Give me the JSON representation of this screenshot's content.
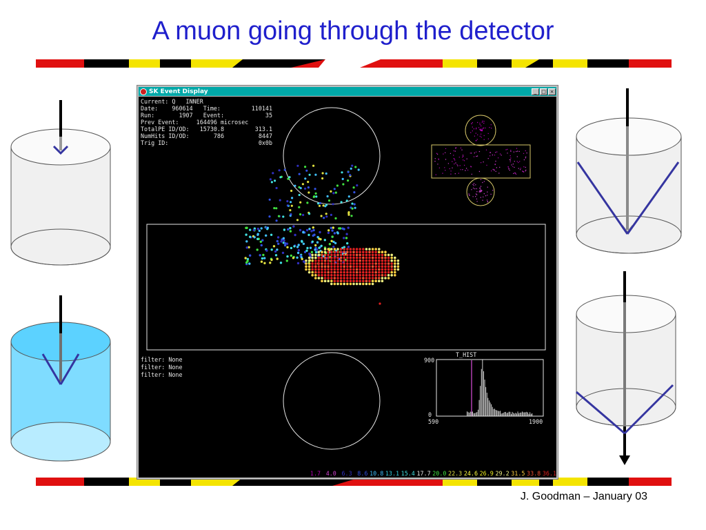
{
  "slide": {
    "title": "A muon going through the detector",
    "footer": "J. Goodman – January 03"
  },
  "window": {
    "title": "SK Event Display",
    "buttons": {
      "minimize": "_",
      "maximize": "□",
      "close": "×"
    }
  },
  "event_info": [
    {
      "label": "Current: Q   INNER",
      "value": ""
    },
    {
      "label": "Date:    960614   Time:",
      "value": "110141"
    },
    {
      "label": "Run:       1907   Event:",
      "value": "35"
    },
    {
      "label": "Prev Event:     164496 microsec",
      "value": ""
    },
    {
      "label": "TotalPE ID/OD:   15730.8",
      "value": "313.1"
    },
    {
      "label": "NumHits ID/OD:       786",
      "value": "8447"
    },
    {
      "label": "Trig ID:",
      "value": "0x0b"
    }
  ],
  "filters": [
    "filter: None",
    "filter: None",
    "filter: None"
  ],
  "histogram": {
    "title": "T_HIST",
    "ymax": "900",
    "ymin": "0",
    "xmin": "590",
    "xmax": "1900"
  },
  "color_scale": [
    {
      "value": "1.7",
      "color": "#b000b0"
    },
    {
      "value": "4.0",
      "color": "#d040d0"
    },
    {
      "value": "6.3",
      "color": "#3030c0"
    },
    {
      "value": "8.6",
      "color": "#3050e0"
    },
    {
      "value": "10.8",
      "color": "#40c0ff"
    },
    {
      "value": "13.1",
      "color": "#30d0e0"
    },
    {
      "value": "15.4",
      "color": "#40e0e0"
    },
    {
      "value": "17.7",
      "color": "#e8e8e8"
    },
    {
      "value": "20.0",
      "color": "#40e040"
    },
    {
      "value": "22.3",
      "color": "#e0e040"
    },
    {
      "value": "24.6",
      "color": "#ffff40"
    },
    {
      "value": "26.9",
      "color": "#f0f020"
    },
    {
      "value": "29.2",
      "color": "#f0f080"
    },
    {
      "value": "31.5",
      "color": "#ffd040"
    },
    {
      "value": "33.8",
      "color": "#f05030"
    },
    {
      "value": "36.1",
      "color": "#e02020"
    }
  ],
  "colors": {
    "title_blue": "#1f1fcc",
    "titlebar": "#00a8a8",
    "cylinder_water": "#7fdcff",
    "cherenkov": "#3535a0"
  }
}
